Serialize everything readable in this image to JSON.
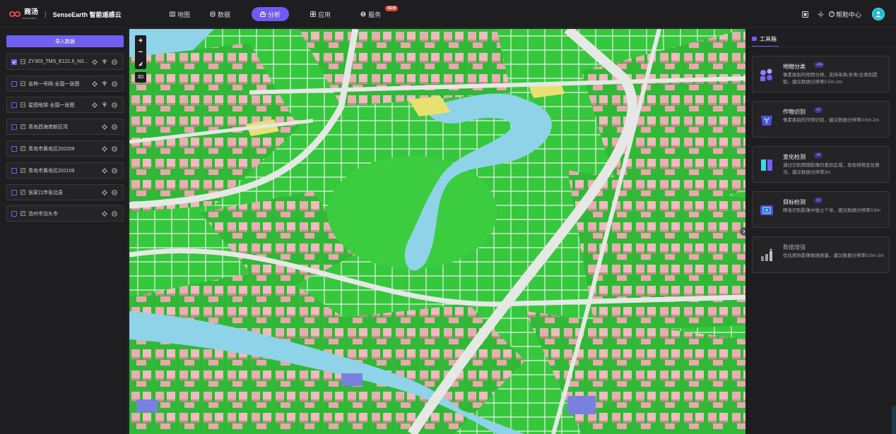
{
  "brand": {
    "logo_text": "商汤",
    "logo_sub": "sensetime",
    "separator": "|",
    "name": "SenseEarth 智能遥感云"
  },
  "nav": {
    "items": [
      {
        "label": "地图",
        "icon": "map-icon"
      },
      {
        "label": "数据",
        "icon": "database-icon"
      },
      {
        "label": "分析",
        "icon": "analysis-icon",
        "active": true
      },
      {
        "label": "应用",
        "icon": "apps-grid-icon"
      },
      {
        "label": "服务",
        "icon": "service-icon",
        "badge": "NEW"
      }
    ]
  },
  "topright": {
    "help_label": "帮助中心",
    "icons": [
      "screen-icon",
      "sun-icon",
      "help-circle-icon",
      "user-avatar-icon"
    ]
  },
  "left": {
    "import_label": "导入数据",
    "layers": [
      {
        "name": "ZY303_TMS_E121.5_N3...",
        "checked": true,
        "type": "raster"
      },
      {
        "name": "吉林一号网·全国一张图",
        "checked": false,
        "type": "raster"
      },
      {
        "name": "星图地球·全国一张图",
        "checked": false,
        "type": "raster"
      },
      {
        "name": "青岛西海岸新区湾",
        "checked": false,
        "type": "vector"
      },
      {
        "name": "青岛市黄岛区202209",
        "checked": false,
        "type": "vector"
      },
      {
        "name": "青岛市黄岛区202109",
        "checked": false,
        "type": "vector"
      },
      {
        "name": "张家口市张北县",
        "checked": false,
        "type": "vector"
      },
      {
        "name": "沧州市泊头市",
        "checked": false,
        "type": "vector"
      }
    ]
  },
  "map": {
    "zoom_in": "+",
    "zoom_out": "−",
    "mode_3d": "3D"
  },
  "right": {
    "tab_label": "工具箱",
    "tools": [
      {
        "title": "地物分类",
        "count": "+24",
        "desc": "像素级别的地物分类，支持单类/多类/全类别提取，建议数据分辨率0.5m-2m"
      },
      {
        "title": "作物识别",
        "count": "+2",
        "desc": "像素级别的作物识别，建议数据分辨率0.5m-2m"
      },
      {
        "title": "变化检测",
        "count": "+4",
        "desc": "通过识别两期影像的差异区域，发现地物变化情况，建议数据分辨率2m"
      },
      {
        "title": "目标检测",
        "count": "+2",
        "desc": "精准识别影像中独立个体，建议数据分辨率0.5m"
      },
      {
        "title": "数据增强",
        "count": "",
        "desc": "优化原始影像数据质量，建议数据分辨率0.5m-2m"
      }
    ]
  },
  "colors": {
    "accent": "#7060f0",
    "badge": "#e8473a",
    "avatar": "#1dbbd0",
    "vegetation": "#34c43a",
    "water": "#8fd3e8",
    "building": "#e9b3b3",
    "road": "#e6e8e6"
  }
}
